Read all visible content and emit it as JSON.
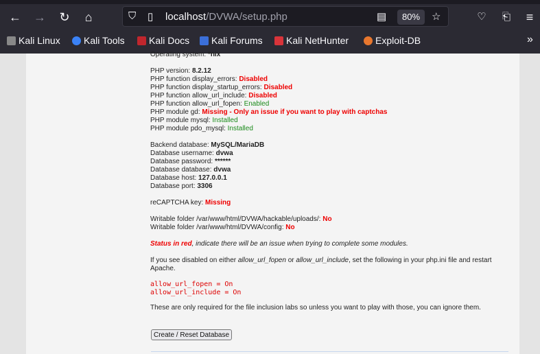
{
  "browser": {
    "url_host": "localhost",
    "url_path": "/DVWA/setup.php",
    "zoom": "80%",
    "bookmarks": [
      "Kali Linux",
      "Kali Tools",
      "Kali Docs",
      "Kali Forums",
      "Kali NetHunter",
      "Exploit-DB"
    ],
    "bookmark_colors": [
      "#888888",
      "#3b82f6",
      "#c0262d",
      "#3b6fd8",
      "#d9343a",
      "#e8772e"
    ]
  },
  "setup": {
    "os": {
      "label": "Operating system: ",
      "value": "*nix"
    },
    "php_version": {
      "label": "PHP version: ",
      "value": "8.2.12"
    },
    "checks": [
      {
        "label": "PHP function display_errors: ",
        "value": "Disabled",
        "status": "red"
      },
      {
        "label": "PHP function display_startup_errors: ",
        "value": "Disabled",
        "status": "red"
      },
      {
        "label": "PHP function allow_url_include: ",
        "value": "Disabled",
        "status": "red"
      },
      {
        "label": "PHP function allow_url_fopen: ",
        "value": "Enabled",
        "status": "green"
      },
      {
        "label": "PHP module gd: ",
        "value": "Missing - Only an issue if you want to play with captchas",
        "status": "red"
      },
      {
        "label": "PHP module mysql: ",
        "value": "Installed",
        "status": "green"
      },
      {
        "label": "PHP module pdo_mysql: ",
        "value": "Installed",
        "status": "green"
      }
    ],
    "db": [
      {
        "label": "Backend database: ",
        "value": "MySQL/MariaDB"
      },
      {
        "label": "Database username: ",
        "value": "dvwa"
      },
      {
        "label": "Database password: ",
        "value": "******"
      },
      {
        "label": "Database database: ",
        "value": "dvwa"
      },
      {
        "label": "Database host: ",
        "value": "127.0.0.1"
      },
      {
        "label": "Database port: ",
        "value": "3306"
      }
    ],
    "recaptcha": {
      "label": "reCAPTCHA key: ",
      "value": "Missing"
    },
    "folders": [
      {
        "label": "Writable folder /var/www/html/DVWA/hackable/uploads/: ",
        "value": "No"
      },
      {
        "label": "Writable folder /var/www/html/DVWA/config: ",
        "value": "No"
      }
    ],
    "status_note": {
      "strong": "Status in red",
      "rest": ", indicate there will be an issue when trying to complete some modules."
    },
    "disabled_note": {
      "p1": "If you see disabled on either ",
      "e1": "allow_url_fopen",
      "p2": " or ",
      "e2": "allow_url_include",
      "p3": ", set the following in your php.ini file and restart",
      "p4": "Apache."
    },
    "code": [
      "allow_url_fopen = On",
      "allow_url_include = On"
    ],
    "inclusion_note": "These are only required for the file inclusion labs so unless you want to play with those, you can ignore them.",
    "button": "Create / Reset Database"
  }
}
